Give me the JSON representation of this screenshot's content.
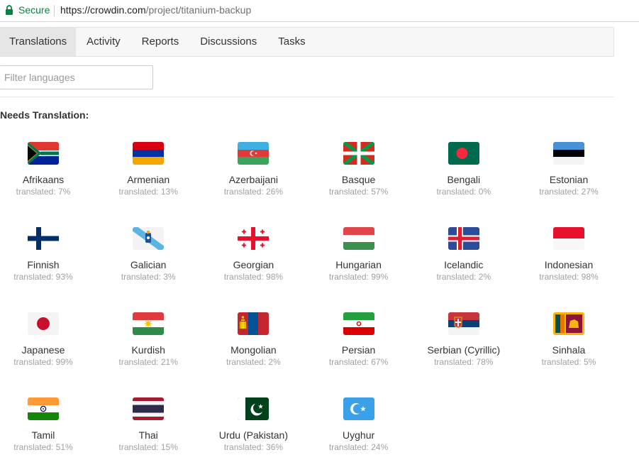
{
  "browser": {
    "secure_label": "Secure",
    "url_host": "https://crowdin.com",
    "url_path": "/project/titanium-backup"
  },
  "tabs": [
    {
      "label": "Translations",
      "active": true
    },
    {
      "label": "Activity"
    },
    {
      "label": "Reports"
    },
    {
      "label": "Discussions"
    },
    {
      "label": "Tasks"
    }
  ],
  "filter": {
    "placeholder": "Filter languages",
    "value": ""
  },
  "section_heading": "Needs Translation:",
  "languages": [
    {
      "name": "Afrikaans",
      "status": "translated: 7%",
      "flag": "south-africa"
    },
    {
      "name": "Armenian",
      "status": "translated: 13%",
      "flag": "armenia"
    },
    {
      "name": "Azerbaijani",
      "status": "translated: 26%",
      "flag": "azerbaijan"
    },
    {
      "name": "Basque",
      "status": "translated: 57%",
      "flag": "basque"
    },
    {
      "name": "Bengali",
      "status": "translated: 0%",
      "flag": "bangladesh"
    },
    {
      "name": "Estonian",
      "status": "translated: 27%",
      "flag": "estonia"
    },
    {
      "name": "Finnish",
      "status": "translated: 93%",
      "flag": "finland"
    },
    {
      "name": "Galician",
      "status": "translated: 3%",
      "flag": "galicia"
    },
    {
      "name": "Georgian",
      "status": "translated: 98%",
      "flag": "georgia"
    },
    {
      "name": "Hungarian",
      "status": "translated: 99%",
      "flag": "hungary"
    },
    {
      "name": "Icelandic",
      "status": "translated: 2%",
      "flag": "iceland"
    },
    {
      "name": "Indonesian",
      "status": "translated: 98%",
      "flag": "indonesia"
    },
    {
      "name": "Japanese",
      "status": "translated: 99%",
      "flag": "japan"
    },
    {
      "name": "Kurdish",
      "status": "translated: 21%",
      "flag": "kurdistan"
    },
    {
      "name": "Mongolian",
      "status": "translated: 2%",
      "flag": "mongolia"
    },
    {
      "name": "Persian",
      "status": "translated: 67%",
      "flag": "iran"
    },
    {
      "name": "Serbian (Cyrillic)",
      "status": "translated: 78%",
      "flag": "serbia"
    },
    {
      "name": "Sinhala",
      "status": "translated: 5%",
      "flag": "sri-lanka"
    },
    {
      "name": "Tamil",
      "status": "translated: 51%",
      "flag": "india"
    },
    {
      "name": "Thai",
      "status": "translated: 15%",
      "flag": "thailand"
    },
    {
      "name": "Urdu (Pakistan)",
      "status": "translated: 36%",
      "flag": "pakistan"
    },
    {
      "name": "Uyghur",
      "status": "translated: 24%",
      "flag": "east-turkestan"
    }
  ],
  "colors": {
    "secure_green": "#0b8043",
    "tab_bar": "#f7f7f7",
    "active_tab": "#e6e6e6",
    "muted_text": "#a0a0a0"
  }
}
